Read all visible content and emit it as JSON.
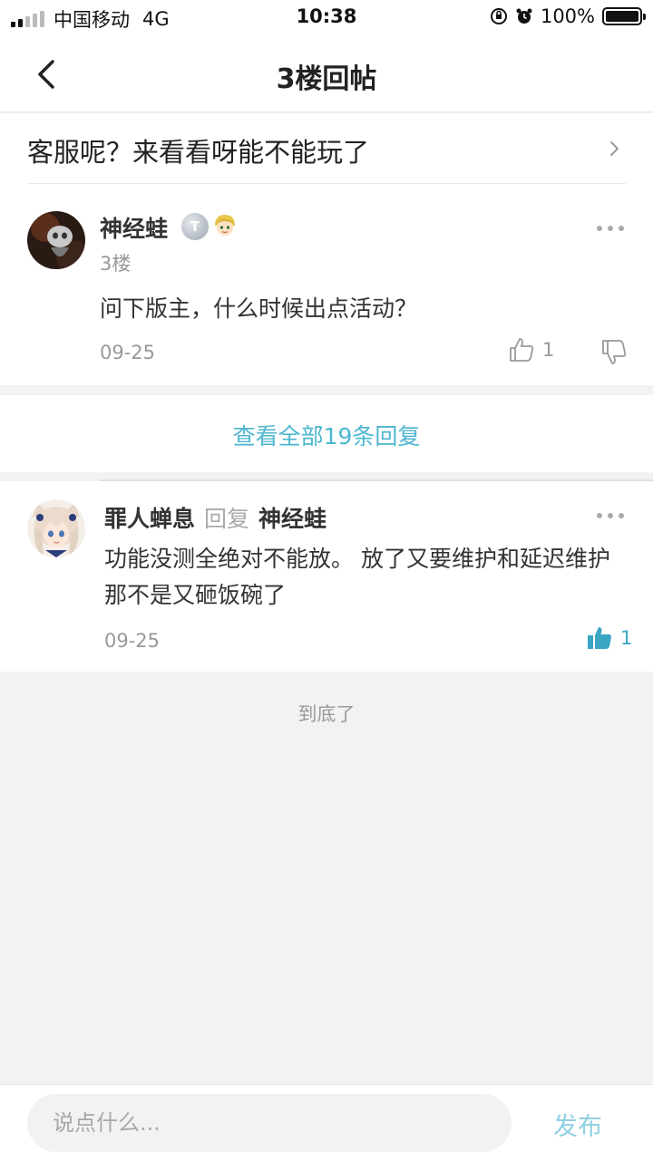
{
  "status_bar": {
    "carrier": "中国移动",
    "network": "4G",
    "time": "10:38",
    "battery": "100%"
  },
  "nav": {
    "title": "3楼回帖",
    "back_icon": "chevron-left-icon"
  },
  "thread": {
    "title": "客服呢？来看看呀能不能玩了",
    "chevron_icon": "chevron-right-icon"
  },
  "post": {
    "username": "神经蛙",
    "badge_text": "T",
    "floor": "3楼",
    "content": "问下版主，什么时候出点活动？",
    "date": "09-25",
    "likes": "1"
  },
  "view_all": {
    "label": "查看全部19条回复"
  },
  "reply": {
    "username": "罪人蝉息",
    "reply_word": "回复",
    "reply_to": "神经蛙",
    "content": "功能没测全绝对不能放。 放了又要维护和延迟维护那不是又砸饭碗了",
    "date": "09-25",
    "likes": "1"
  },
  "end_text": "到底了",
  "bottom": {
    "placeholder": "说点什么...",
    "publish_label": "发布"
  },
  "colors": {
    "accent": "#4db6cf",
    "publish": "#8fd0e2",
    "background": "#f2f2f2"
  }
}
